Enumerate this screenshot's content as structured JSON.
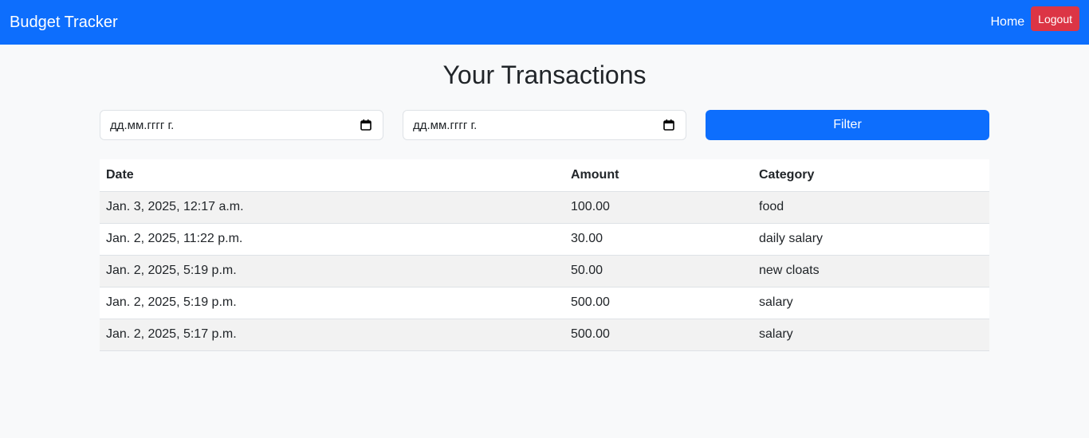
{
  "navbar": {
    "brand": "Budget Tracker",
    "home_label": "Home",
    "logout_label": "Logout"
  },
  "page": {
    "title": "Your Transactions"
  },
  "filter": {
    "start_date_value": "дд.мм.гггг г.",
    "end_date_value": "дд.мм.гггг г.",
    "button_label": "Filter"
  },
  "table": {
    "headers": [
      "Date",
      "Amount",
      "Category"
    ],
    "rows": [
      {
        "date": "Jan. 3, 2025, 12:17 a.m.",
        "amount": "100.00",
        "category": "food"
      },
      {
        "date": "Jan. 2, 2025, 11:22 p.m.",
        "amount": "30.00",
        "category": "daily salary"
      },
      {
        "date": "Jan. 2, 2025, 5:19 p.m.",
        "amount": "50.00",
        "category": "new cloats"
      },
      {
        "date": "Jan. 2, 2025, 5:19 p.m.",
        "amount": "500.00",
        "category": "salary"
      },
      {
        "date": "Jan. 2, 2025, 5:17 p.m.",
        "amount": "500.00",
        "category": "salary"
      }
    ]
  },
  "colors": {
    "primary": "#0d6efd",
    "danger": "#dc3545",
    "background": "#f8f9fa"
  },
  "icons": {
    "date_picker": "calendar-icon"
  }
}
